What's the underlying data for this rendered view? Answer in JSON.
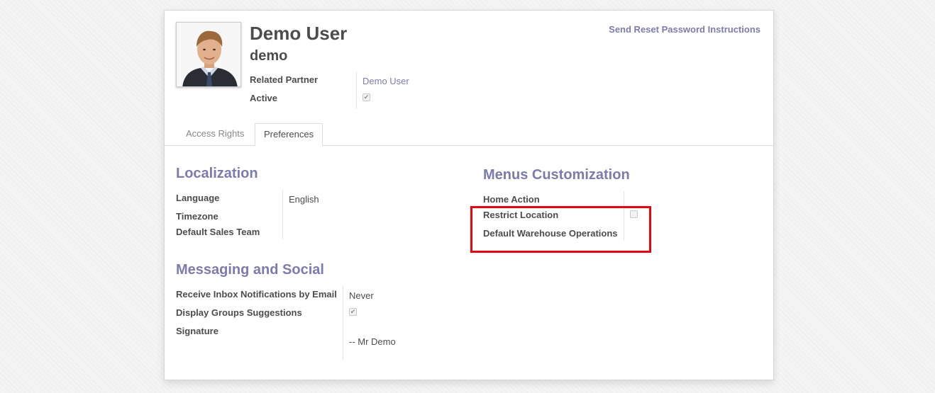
{
  "header": {
    "name": "Demo User",
    "login": "demo",
    "reset_link": "Send Reset Password Instructions"
  },
  "fields": {
    "related_partner": {
      "label": "Related Partner",
      "value": "Demo User"
    },
    "active": {
      "label": "Active",
      "checked": true
    }
  },
  "tabs": [
    {
      "label": "Access Rights",
      "active": false
    },
    {
      "label": "Preferences",
      "active": true
    }
  ],
  "localization": {
    "title": "Localization",
    "language": {
      "label": "Language",
      "value": "English"
    },
    "timezone": {
      "label": "Timezone",
      "value": ""
    },
    "sales_team": {
      "label": "Default Sales Team",
      "value": ""
    }
  },
  "menus": {
    "title": "Menus Customization",
    "home_action": {
      "label": "Home Action",
      "value": ""
    },
    "restrict_location": {
      "label": "Restrict Location",
      "checked": false
    },
    "warehouse_ops": {
      "label": "Default Warehouse Operations",
      "value": ""
    }
  },
  "messaging": {
    "title": "Messaging and Social",
    "inbox": {
      "label": "Receive Inbox Notifications by Email",
      "value": "Never"
    },
    "groups": {
      "label": "Display Groups Suggestions",
      "checked": true
    },
    "signature": {
      "label": "Signature",
      "value": "-- Mr Demo"
    }
  },
  "colors": {
    "accent": "#7c7bad",
    "highlight_box": "#e3070f"
  }
}
